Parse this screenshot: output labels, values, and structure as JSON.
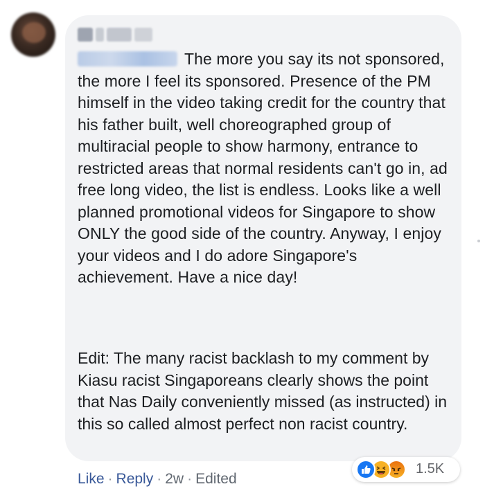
{
  "comment": {
    "text_para1_line1": "The more you say its not",
    "text_para1_rest": "sponsored, the more I feel its sponsored. Presence of the PM himself in the video taking credit for the country that his father built, well choreographed group of multiracial people to show harmony, entrance to restricted areas that normal residents can't go in, ad free long video, the list is endless. Looks like a well planned promotional videos for Singapore to show ONLY the good side of the country. Anyway, I enjoy your videos and I do adore Singapore's achievement. Have a nice day!",
    "text_para2": "Edit: The many racist backlash to my comment by Kiasu racist Singaporeans clearly shows the point that Nas Daily conveniently missed (as instructed) in this so called almost perfect non racist country."
  },
  "actions": {
    "like_label": "Like",
    "reply_label": "Reply",
    "separator": "·",
    "time": "2w",
    "edited": "Edited"
  },
  "reactions": {
    "count": "1.5K",
    "icons": [
      "like-icon",
      "haha-icon",
      "angry-icon"
    ]
  },
  "colors": {
    "bubble": "#f2f3f5",
    "link": "#385898",
    "like": "#1877f2",
    "haha": "#f7b125",
    "angry": "#e9710f"
  }
}
